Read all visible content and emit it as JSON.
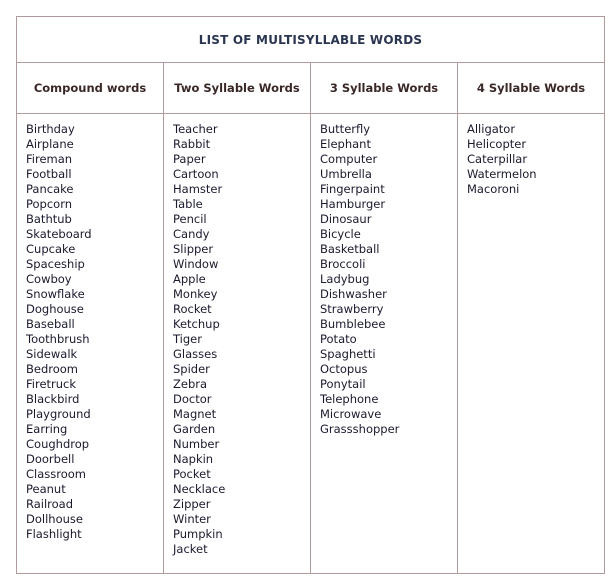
{
  "title": "LIST OF MULTISYLLABLE WORDS",
  "columns": [
    {
      "header": "Compound words",
      "words": [
        "Birthday",
        "Airplane",
        "Fireman",
        "Football",
        "Pancake",
        "Popcorn",
        "Bathtub",
        "Skateboard",
        "Cupcake",
        "Spaceship",
        "Cowboy",
        "Snowflake",
        "Doghouse",
        "Baseball",
        "Toothbrush",
        "Sidewalk",
        "Bedroom",
        "Firetruck",
        "Blackbird",
        "Playground",
        "Earring",
        "Coughdrop",
        "Doorbell",
        "Classroom",
        "Peanut",
        "Railroad",
        "Dollhouse",
        "Flashlight"
      ]
    },
    {
      "header": "Two Syllable Words",
      "words": [
        "Teacher",
        "Rabbit",
        "Paper",
        "Cartoon",
        "Hamster",
        "Table",
        "Pencil",
        "Candy",
        "Slipper",
        "Window",
        "Apple",
        "Monkey",
        "Rocket",
        "Ketchup",
        "Tiger",
        "Glasses",
        "Spider",
        "Zebra",
        "Doctor",
        "Magnet",
        "Garden",
        "Number",
        "Napkin",
        "Pocket",
        "Necklace",
        "Zipper",
        "Winter",
        "Pumpkin",
        "Jacket"
      ]
    },
    {
      "header": "3 Syllable Words",
      "words": [
        "Butterfly",
        "Elephant",
        "Computer",
        "Umbrella",
        "Fingerpaint",
        "Hamburger",
        "Dinosaur",
        "Bicycle",
        "Basketball",
        "Broccoli",
        "Ladybug",
        "Dishwasher",
        "Strawberry",
        "Bumblebee",
        "Potato",
        "Spaghetti",
        "Octopus",
        "Ponytail",
        "Telephone",
        "Microwave",
        "Grassshopper"
      ]
    },
    {
      "header": "4 Syllable Words",
      "words": [
        "Alligator",
        "Helicopter",
        "Caterpillar",
        "Watermelon",
        "Macoroni"
      ]
    }
  ]
}
